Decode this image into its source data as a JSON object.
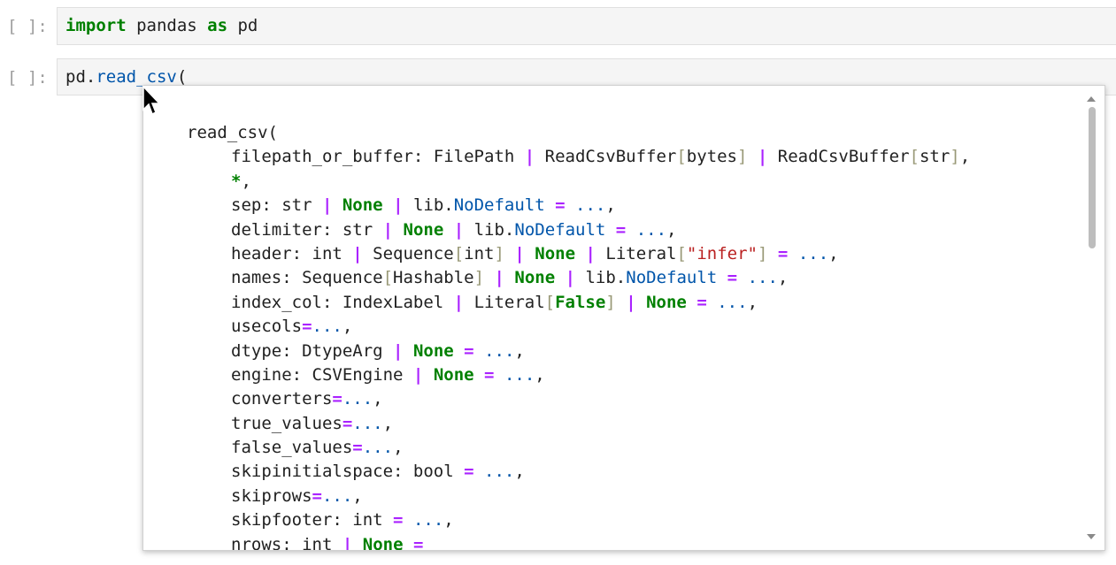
{
  "cells": [
    {
      "prompt": "[ ]:",
      "code": [
        {
          "t": "import",
          "c": "kw"
        },
        {
          "t": " pandas ",
          "c": ""
        },
        {
          "t": "as",
          "c": "kw"
        },
        {
          "t": " pd",
          "c": ""
        }
      ]
    },
    {
      "prompt": "[ ]:",
      "code": [
        {
          "t": "pd.",
          "c": ""
        },
        {
          "t": "read_csv",
          "c": "fn"
        },
        {
          "t": "(",
          "c": ""
        }
      ]
    }
  ],
  "tooltip": {
    "lines": [
      {
        "indent": false,
        "tokens": [
          {
            "t": "read_csv(",
            "c": ""
          }
        ]
      },
      {
        "indent": true,
        "tokens": [
          {
            "t": "filepath_or_buffer: FilePath ",
            "c": ""
          },
          {
            "t": "|",
            "c": "op"
          },
          {
            "t": " ReadCsvBuffer",
            "c": ""
          },
          {
            "t": "[",
            "c": "br"
          },
          {
            "t": "bytes",
            "c": ""
          },
          {
            "t": "]",
            "c": "br"
          },
          {
            "t": " ",
            "c": ""
          },
          {
            "t": "|",
            "c": "op"
          },
          {
            "t": " ReadCsvBuffer",
            "c": ""
          },
          {
            "t": "[",
            "c": "br"
          },
          {
            "t": "str",
            "c": ""
          },
          {
            "t": "]",
            "c": "br"
          },
          {
            "t": ",",
            "c": ""
          }
        ]
      },
      {
        "indent": true,
        "tokens": [
          {
            "t": "*",
            "c": "kw"
          },
          {
            "t": ",",
            "c": ""
          }
        ]
      },
      {
        "indent": true,
        "tokens": [
          {
            "t": "sep: str ",
            "c": ""
          },
          {
            "t": "|",
            "c": "op"
          },
          {
            "t": " ",
            "c": ""
          },
          {
            "t": "None",
            "c": "kw"
          },
          {
            "t": " ",
            "c": ""
          },
          {
            "t": "|",
            "c": "op"
          },
          {
            "t": " lib.",
            "c": ""
          },
          {
            "t": "NoDefault",
            "c": "fn"
          },
          {
            "t": " ",
            "c": ""
          },
          {
            "t": "=",
            "c": "op"
          },
          {
            "t": " ",
            "c": ""
          },
          {
            "t": "...",
            "c": "num"
          },
          {
            "t": ",",
            "c": ""
          }
        ]
      },
      {
        "indent": true,
        "tokens": [
          {
            "t": "delimiter: str ",
            "c": ""
          },
          {
            "t": "|",
            "c": "op"
          },
          {
            "t": " ",
            "c": ""
          },
          {
            "t": "None",
            "c": "kw"
          },
          {
            "t": " ",
            "c": ""
          },
          {
            "t": "|",
            "c": "op"
          },
          {
            "t": " lib.",
            "c": ""
          },
          {
            "t": "NoDefault",
            "c": "fn"
          },
          {
            "t": " ",
            "c": ""
          },
          {
            "t": "=",
            "c": "op"
          },
          {
            "t": " ",
            "c": ""
          },
          {
            "t": "...",
            "c": "num"
          },
          {
            "t": ",",
            "c": ""
          }
        ]
      },
      {
        "indent": true,
        "tokens": [
          {
            "t": "header: int ",
            "c": ""
          },
          {
            "t": "|",
            "c": "op"
          },
          {
            "t": " Sequence",
            "c": ""
          },
          {
            "t": "[",
            "c": "br"
          },
          {
            "t": "int",
            "c": ""
          },
          {
            "t": "]",
            "c": "br"
          },
          {
            "t": " ",
            "c": ""
          },
          {
            "t": "|",
            "c": "op"
          },
          {
            "t": " ",
            "c": ""
          },
          {
            "t": "None",
            "c": "kw"
          },
          {
            "t": " ",
            "c": ""
          },
          {
            "t": "|",
            "c": "op"
          },
          {
            "t": " Literal",
            "c": ""
          },
          {
            "t": "[",
            "c": "br"
          },
          {
            "t": "\"infer\"",
            "c": "str"
          },
          {
            "t": "]",
            "c": "br"
          },
          {
            "t": " ",
            "c": ""
          },
          {
            "t": "=",
            "c": "op"
          },
          {
            "t": " ",
            "c": ""
          },
          {
            "t": "...",
            "c": "num"
          },
          {
            "t": ",",
            "c": ""
          }
        ]
      },
      {
        "indent": true,
        "tokens": [
          {
            "t": "names: Sequence",
            "c": ""
          },
          {
            "t": "[",
            "c": "br"
          },
          {
            "t": "Hashable",
            "c": ""
          },
          {
            "t": "]",
            "c": "br"
          },
          {
            "t": " ",
            "c": ""
          },
          {
            "t": "|",
            "c": "op"
          },
          {
            "t": " ",
            "c": ""
          },
          {
            "t": "None",
            "c": "kw"
          },
          {
            "t": " ",
            "c": ""
          },
          {
            "t": "|",
            "c": "op"
          },
          {
            "t": " lib.",
            "c": ""
          },
          {
            "t": "NoDefault",
            "c": "fn"
          },
          {
            "t": " ",
            "c": ""
          },
          {
            "t": "=",
            "c": "op"
          },
          {
            "t": " ",
            "c": ""
          },
          {
            "t": "...",
            "c": "num"
          },
          {
            "t": ",",
            "c": ""
          }
        ]
      },
      {
        "indent": true,
        "tokens": [
          {
            "t": "index_col: IndexLabel ",
            "c": ""
          },
          {
            "t": "|",
            "c": "op"
          },
          {
            "t": " Literal",
            "c": ""
          },
          {
            "t": "[",
            "c": "br"
          },
          {
            "t": "False",
            "c": "kw"
          },
          {
            "t": "]",
            "c": "br"
          },
          {
            "t": " ",
            "c": ""
          },
          {
            "t": "|",
            "c": "op"
          },
          {
            "t": " ",
            "c": ""
          },
          {
            "t": "None",
            "c": "kw"
          },
          {
            "t": " ",
            "c": ""
          },
          {
            "t": "=",
            "c": "op"
          },
          {
            "t": " ",
            "c": ""
          },
          {
            "t": "...",
            "c": "num"
          },
          {
            "t": ",",
            "c": ""
          }
        ]
      },
      {
        "indent": true,
        "tokens": [
          {
            "t": "usecols",
            "c": ""
          },
          {
            "t": "=",
            "c": "op"
          },
          {
            "t": "...",
            "c": "num"
          },
          {
            "t": ",",
            "c": ""
          }
        ]
      },
      {
        "indent": true,
        "tokens": [
          {
            "t": "dtype: DtypeArg ",
            "c": ""
          },
          {
            "t": "|",
            "c": "op"
          },
          {
            "t": " ",
            "c": ""
          },
          {
            "t": "None",
            "c": "kw"
          },
          {
            "t": " ",
            "c": ""
          },
          {
            "t": "=",
            "c": "op"
          },
          {
            "t": " ",
            "c": ""
          },
          {
            "t": "...",
            "c": "num"
          },
          {
            "t": ",",
            "c": ""
          }
        ]
      },
      {
        "indent": true,
        "tokens": [
          {
            "t": "engine: CSVEngine ",
            "c": ""
          },
          {
            "t": "|",
            "c": "op"
          },
          {
            "t": " ",
            "c": ""
          },
          {
            "t": "None",
            "c": "kw"
          },
          {
            "t": " ",
            "c": ""
          },
          {
            "t": "=",
            "c": "op"
          },
          {
            "t": " ",
            "c": ""
          },
          {
            "t": "...",
            "c": "num"
          },
          {
            "t": ",",
            "c": ""
          }
        ]
      },
      {
        "indent": true,
        "tokens": [
          {
            "t": "converters",
            "c": ""
          },
          {
            "t": "=",
            "c": "op"
          },
          {
            "t": "...",
            "c": "num"
          },
          {
            "t": ",",
            "c": ""
          }
        ]
      },
      {
        "indent": true,
        "tokens": [
          {
            "t": "true_values",
            "c": ""
          },
          {
            "t": "=",
            "c": "op"
          },
          {
            "t": "...",
            "c": "num"
          },
          {
            "t": ",",
            "c": ""
          }
        ]
      },
      {
        "indent": true,
        "tokens": [
          {
            "t": "false_values",
            "c": ""
          },
          {
            "t": "=",
            "c": "op"
          },
          {
            "t": "...",
            "c": "num"
          },
          {
            "t": ",",
            "c": ""
          }
        ]
      },
      {
        "indent": true,
        "tokens": [
          {
            "t": "skipinitialspace: bool ",
            "c": ""
          },
          {
            "t": "=",
            "c": "op"
          },
          {
            "t": " ",
            "c": ""
          },
          {
            "t": "...",
            "c": "num"
          },
          {
            "t": ",",
            "c": ""
          }
        ]
      },
      {
        "indent": true,
        "tokens": [
          {
            "t": "skiprows",
            "c": ""
          },
          {
            "t": "=",
            "c": "op"
          },
          {
            "t": "...",
            "c": "num"
          },
          {
            "t": ",",
            "c": ""
          }
        ]
      },
      {
        "indent": true,
        "tokens": [
          {
            "t": "skipfooter: int ",
            "c": ""
          },
          {
            "t": "=",
            "c": "op"
          },
          {
            "t": " ",
            "c": ""
          },
          {
            "t": "...",
            "c": "num"
          },
          {
            "t": ",",
            "c": ""
          }
        ]
      },
      {
        "indent": true,
        "tokens": [
          {
            "t": "nrows: int ",
            "c": ""
          },
          {
            "t": "|",
            "c": "op"
          },
          {
            "t": " ",
            "c": ""
          },
          {
            "t": "None",
            "c": "kw"
          },
          {
            "t": " ",
            "c": ""
          },
          {
            "t": "=",
            "c": "op"
          }
        ]
      }
    ]
  },
  "icons": {
    "cursor": "mouse-pointer-icon",
    "scroll_up": "scroll-up-arrow-icon",
    "scroll_down": "scroll-down-arrow-icon"
  },
  "colors": {
    "keyword": "#008000",
    "function": "#0055aa",
    "operator": "#aa22ff",
    "string": "#ba2121",
    "bracket": "#999977"
  }
}
